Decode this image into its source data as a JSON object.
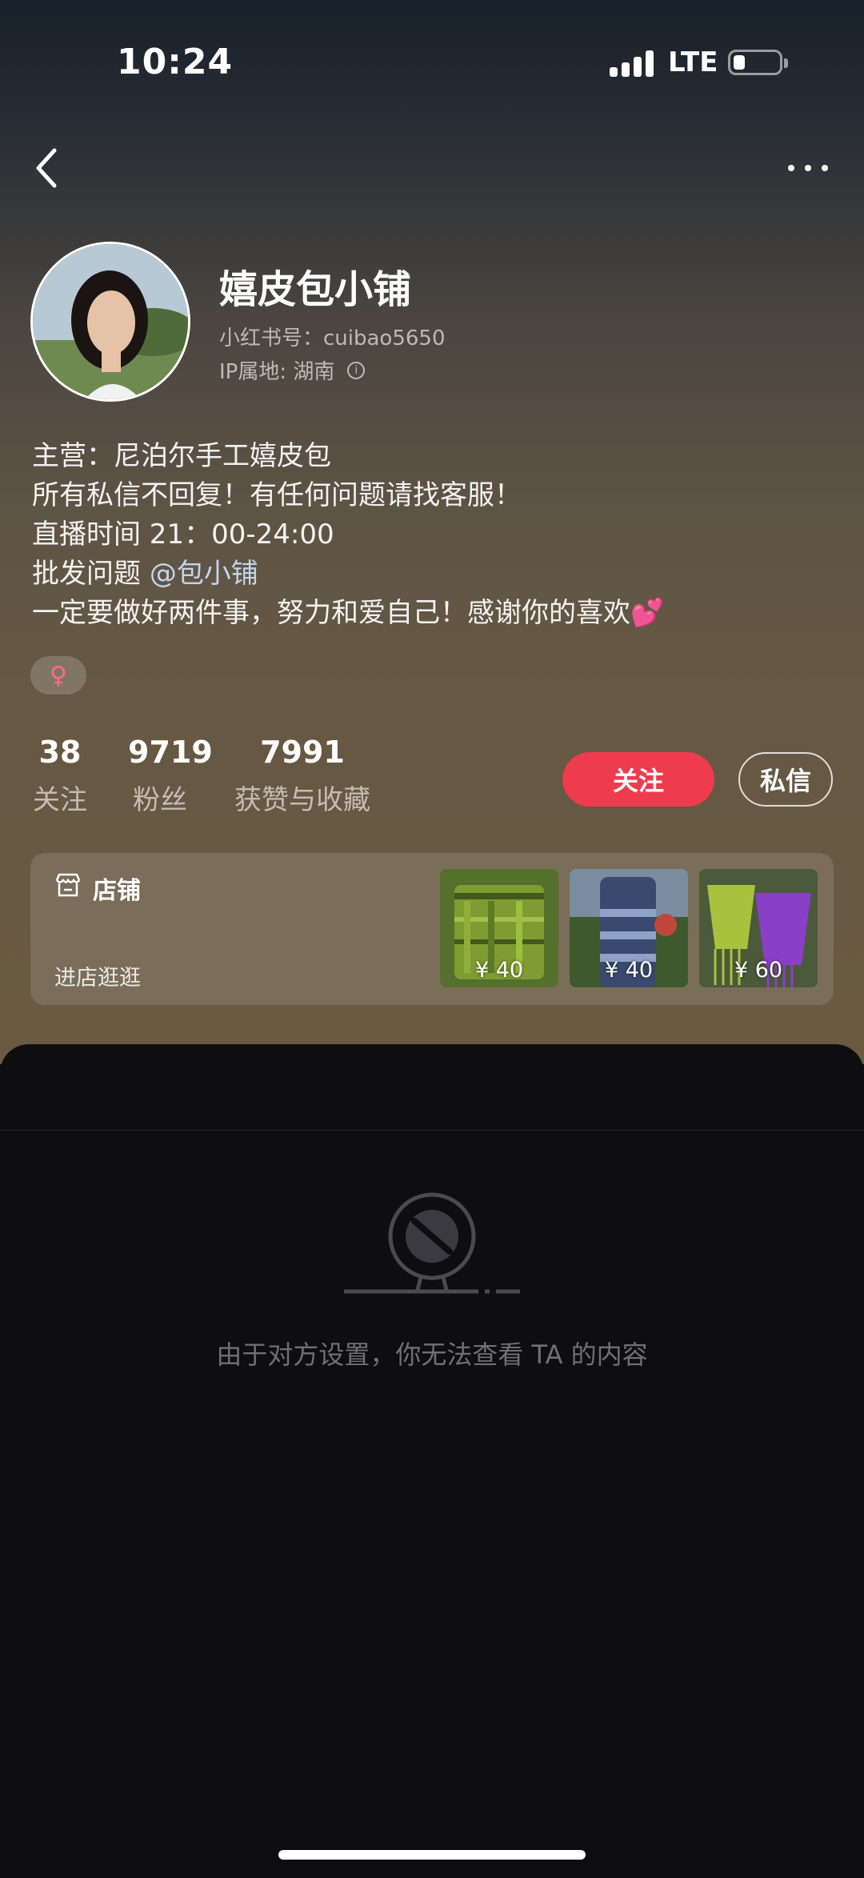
{
  "status_bar": {
    "time": "10:24",
    "network": "LTE",
    "battery_icon": "battery-low-icon",
    "signal_icon": "signal-icon"
  },
  "nav": {
    "back_icon": "chevron-left-icon",
    "more_icon": "more-dots-icon"
  },
  "profile": {
    "name": "嬉皮包小铺",
    "red_id": "小红书号：cuibao5650",
    "ip_location": "IP属地: 湖南",
    "info_icon": "info-icon",
    "bio": {
      "line1": "主营：尼泊尔手工嬉皮包",
      "line2": "所有私信不回复！有任何问题请找客服！",
      "line3": "直播时间 21：00-24:00",
      "line4_prefix": "批发问题",
      "line4_mention": "@包小铺",
      "line5": "一定要做好两件事，努力和爱自己！感谢你的喜欢",
      "line5_emoji": "💕"
    },
    "gender": "♀"
  },
  "stats": [
    {
      "value": "38",
      "label": "关注"
    },
    {
      "value": "9719",
      "label": "粉丝"
    },
    {
      "value": "7991",
      "label": "获赞与收藏"
    }
  ],
  "actions": {
    "follow": "关注",
    "message": "私信"
  },
  "shop": {
    "title": "店铺",
    "subtitle": "进店逛逛",
    "icon": "shop-icon",
    "products": [
      {
        "price": "¥ 40"
      },
      {
        "price": "¥ 40"
      },
      {
        "price": "¥ 60"
      }
    ]
  },
  "empty_state": {
    "icon": "blocked-icon",
    "message": "由于对方设置，你无法查看 TA 的内容"
  },
  "colors": {
    "accent": "#ee3b4e",
    "sheet_bg": "#0e0e11",
    "mention": "#c3d4ec",
    "gender": "#ff6b8a"
  }
}
